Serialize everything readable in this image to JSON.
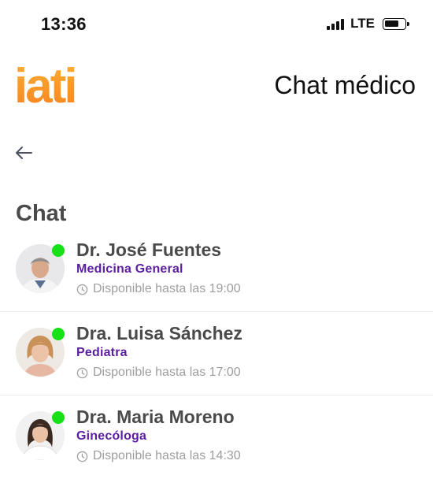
{
  "status_bar": {
    "time": "13:36",
    "network": "LTE",
    "signal_bars": 4,
    "battery_level": 0.75
  },
  "header": {
    "logo_text": "iati",
    "title": "Chat médico"
  },
  "navigation": {
    "back_icon": "arrow-left-icon"
  },
  "section": {
    "title": "Chat"
  },
  "doctors": [
    {
      "name": "Dr. José Fuentes",
      "specialty": "Medicina General",
      "availability": "Disponible hasta las 19:00",
      "online": true
    },
    {
      "name": "Dra. Luisa Sánchez",
      "specialty": "Pediatra",
      "availability": "Disponible hasta las 17:00",
      "online": true
    },
    {
      "name": "Dra. Maria Moreno",
      "specialty": "Ginecóloga",
      "availability": "Disponible hasta las 14:30",
      "online": true
    }
  ],
  "colors": {
    "brand_orange": "#f7941d",
    "specialty_purple": "#5b1ea0",
    "online_green": "#16e016"
  }
}
